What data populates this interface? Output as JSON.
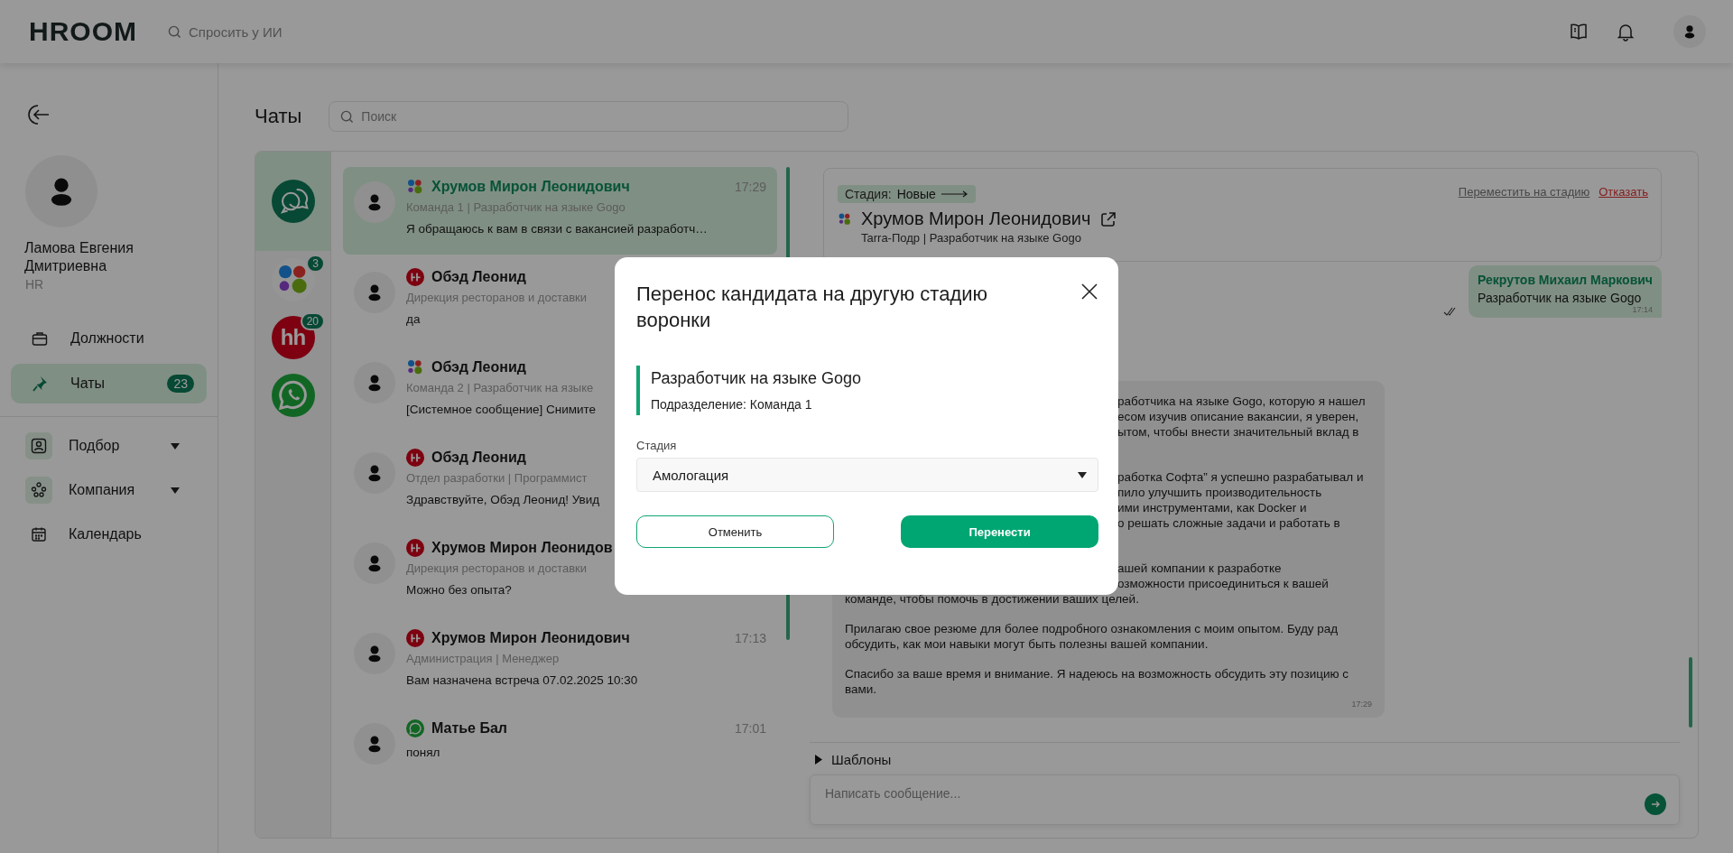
{
  "header": {
    "logo": "HROOM",
    "search_placeholder": "Спросить у ИИ"
  },
  "sidebar": {
    "user": {
      "name": "Ламова Евгения Дмитриевна",
      "role": "HR"
    },
    "nav": [
      {
        "label": "Должности",
        "selected": false
      },
      {
        "label": "Чаты",
        "selected": true,
        "badge": "23"
      }
    ],
    "sections": [
      {
        "label": "Подбор",
        "kind": "group"
      },
      {
        "label": "Компания",
        "kind": "group"
      },
      {
        "label": "Календарь",
        "kind": "link"
      }
    ]
  },
  "chats_page": {
    "title": "Чаты",
    "search_placeholder": "Поиск",
    "channels": [
      {
        "kind": "all",
        "selected": true
      },
      {
        "kind": "multi",
        "badge": "3",
        "selected": false
      },
      {
        "kind": "hh",
        "label": "hh",
        "badge": "20",
        "selected": false
      },
      {
        "kind": "whatsapp",
        "selected": false
      }
    ],
    "chats": [
      {
        "kind": "multi",
        "name": "Хрумов Мирон Леонидович",
        "time": "17:29",
        "subtitle": "Команда 1 | Разработчик на языке Gogo",
        "message": "Я обращаюсь к вам в связи с вакансией разработч…",
        "selected": true
      },
      {
        "kind": "hh",
        "name": "Обэд Леонид",
        "subtitle": "Дирекция ресторанов и доставки",
        "message": "да",
        "selected": false
      },
      {
        "kind": "multi",
        "name": "Обэд Леонид",
        "subtitle": "Команда 2 | Разработчик на языке",
        "message": "[Системное сообщение] Снимите",
        "selected": false
      },
      {
        "kind": "hh",
        "name": "Обэд Леонид",
        "subtitle": "Отдел разработки | Программист",
        "message": "Здравствуйте, Обэд Леонид! Увид",
        "selected": false
      },
      {
        "kind": "hh",
        "name": "Хрумов Мирон Леонидов",
        "subtitle": "Дирекция ресторанов и доставки",
        "message": "Можно без опыта?",
        "selected": false
      },
      {
        "kind": "hh",
        "name": "Хрумов Мирон Леонидович",
        "time": "17:13",
        "subtitle": "Администрация | Менеджер",
        "message": "Вам назначена встреча 07.02.2025 10:30",
        "selected": false
      },
      {
        "kind": "whatsapp",
        "name": "Матье Бал",
        "time": "17:01",
        "message": "понял",
        "selected": false
      }
    ]
  },
  "conversation": {
    "candidate": {
      "stage_label": "Стадия:",
      "stage": "Новые",
      "move_link": "Переместить на стадию",
      "reject_link": "Отказать",
      "kind": "multi",
      "name": "Хрумов Мирон Леонидович",
      "subtitle": "Tarra-Подр | Разработчик на языке Gogo"
    },
    "messages": [
      {
        "kind": "outgoing",
        "sender": "Рекрутов Михаил Маркович",
        "text": "Разработчик на языке Gogo",
        "time": "17:14",
        "read": true
      },
      {
        "kind": "incoming",
        "time": "17:29",
        "paragraphs": [
          {
            "lines": [
              {
                "kind": "partial",
                "text": "работчика на языке Gogo, которую я нашел"
              },
              {
                "kind": "partial",
                "text": "есом изучив описание вакансии, я уверен,"
              },
              {
                "kind": "partial",
                "text": "ытом, чтобы внести значительный вклад в"
              }
            ]
          },
          {
            "lines": [
              {
                "kind": "partial",
                "text": "работка Софта” я успешно разрабатывал и"
              },
              {
                "kind": "partial",
                "text": "пило улучшить производительность"
              },
              {
                "kind": "partial",
                "text": "ими инструментами, как Docker и"
              },
              {
                "kind": "partial",
                "text": "о решать сложные задачи и работать в"
              }
            ]
          },
          {
            "lines": [
              {
                "kind": "partial",
                "text": "ашей компании к разработке"
              },
              {
                "kind": "partial",
                "text": "озможности присоединиться к вашей"
              },
              {
                "kind": "whole",
                "text": "команде, чтобы помочь в достижении ваших целей."
              }
            ]
          },
          {
            "lines": [
              {
                "kind": "whole",
                "text": "Прилагаю свое резюме для более подробного ознакомления с моим опытом. Буду рад обсудить, как мои навыки могут быть полезны вашей компании."
              }
            ]
          },
          {
            "lines": [
              {
                "kind": "whole",
                "text": "Спасибо за ваше время и внимание. Я надеюсь на возможность обсудить эту позицию с вами."
              }
            ]
          }
        ]
      }
    ],
    "templates_label": "Шаблоны",
    "input_placeholder": "Написать сообщение..."
  },
  "modal": {
    "title": "Перенос кандидата на другую стадию воронки",
    "vacancy": "Разработчик на языке Gogo",
    "department": "Подразделение: Команда 1",
    "field_label": "Стадия",
    "field_value": "Амологация",
    "cancel": "Отменить",
    "confirm": "Перенести"
  }
}
